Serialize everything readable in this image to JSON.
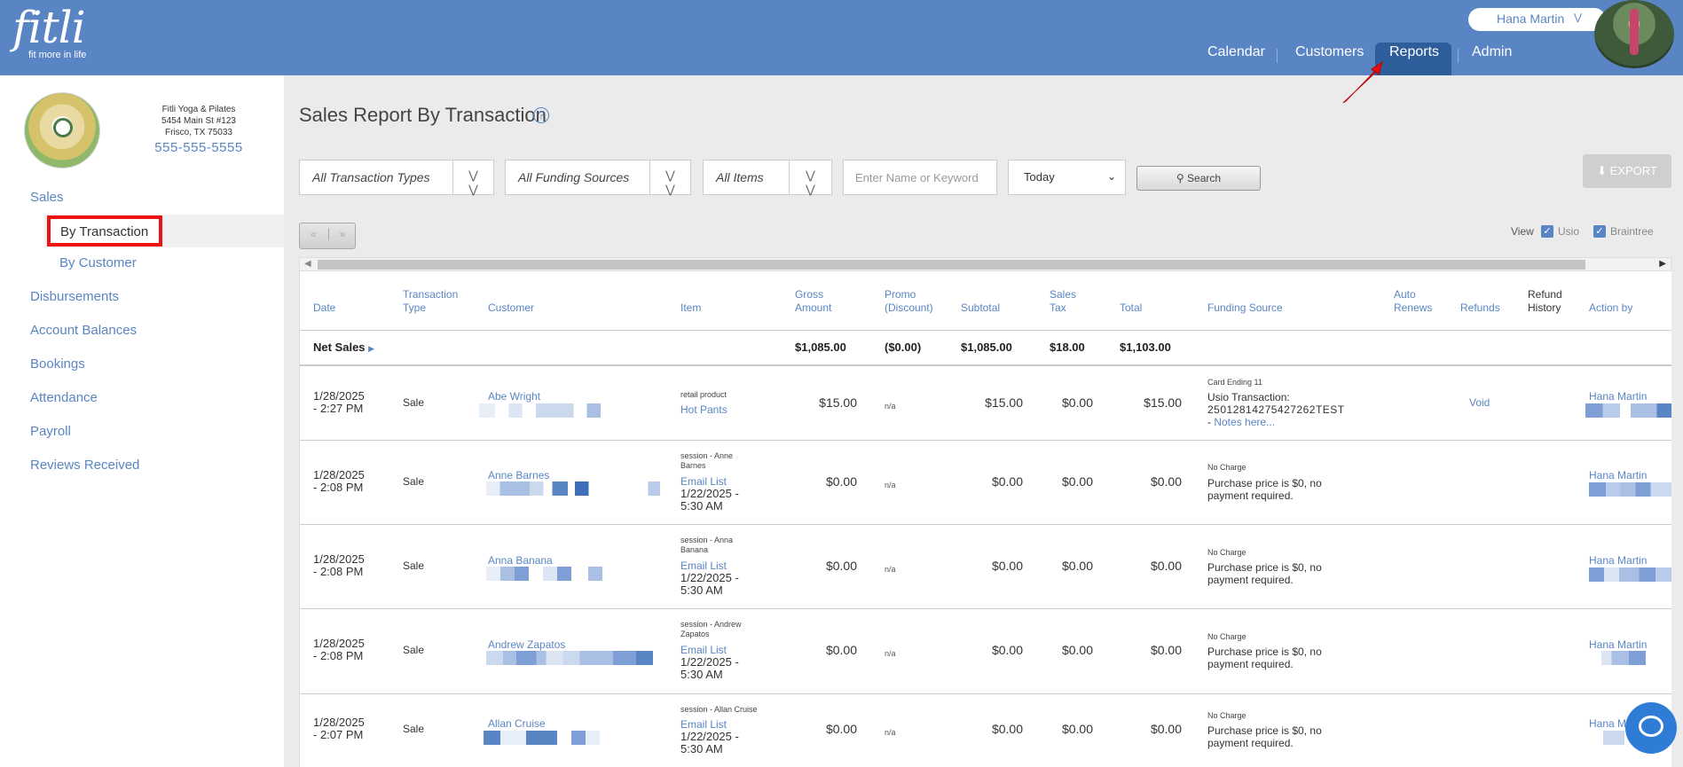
{
  "app": {
    "logo": "fitli",
    "tagline": "fit more in life"
  },
  "header": {
    "user_name": "Hana Martin",
    "nav": [
      {
        "label": "Calendar"
      },
      {
        "label": "Customers"
      },
      {
        "label": "Reports"
      },
      {
        "label": "Admin"
      }
    ]
  },
  "studio": {
    "name": "Fitli Yoga & Pilates",
    "address1": "5454 Main St #123",
    "address2": "Frisco, TX 75033",
    "phone": "555-555-5555"
  },
  "sidebar": {
    "items": [
      {
        "label": "Sales"
      },
      {
        "label": "By Transaction"
      },
      {
        "label": "By Customer"
      },
      {
        "label": "Disbursements"
      },
      {
        "label": "Account Balances"
      },
      {
        "label": "Bookings"
      },
      {
        "label": "Attendance"
      },
      {
        "label": "Payroll"
      },
      {
        "label": "Reviews Received"
      }
    ]
  },
  "page": {
    "title": "Sales Report By Transaction",
    "help": "?"
  },
  "filters": {
    "transaction_types": "All Transaction Types",
    "funding_sources": "All Funding Sources",
    "items": "All Items",
    "keyword_placeholder": "Enter Name or Keyword",
    "date_range": "Today",
    "search_label": "Search",
    "export_label": "EXPORT"
  },
  "pager": {
    "prev": "«",
    "next": "»"
  },
  "view": {
    "label": "View",
    "options": [
      "Usio",
      "Braintree"
    ]
  },
  "table": {
    "headers": {
      "date": "Date",
      "type1": "Transaction",
      "type2": "Type",
      "customer": "Customer",
      "item": "Item",
      "gross1": "Gross",
      "gross2": "Amount",
      "promo1": "Promo",
      "promo2": "(Discount)",
      "subtotal": "Subtotal",
      "tax1": "Sales",
      "tax2": "Tax",
      "total": "Total",
      "funding": "Funding Source",
      "auto1": "Auto",
      "auto2": "Renews",
      "refunds": "Refunds",
      "rh1": "Refund",
      "rh2": "History",
      "action": "Action by"
    },
    "net_sales": {
      "label": "Net Sales",
      "gross": "$1,085.00",
      "promo": "($0.00)",
      "subtotal": "$1,085.00",
      "tax": "$18.00",
      "total": "$1,103.00"
    },
    "rows": [
      {
        "date1": "1/28/2025",
        "date2": "- 2:27 PM",
        "type": "Sale",
        "customer": "Abe Wright",
        "item_type": "retail product",
        "item_name": "Hot Pants",
        "gross": "$15.00",
        "promo": "n/a",
        "subtotal": "$15.00",
        "tax": "$0.00",
        "total": "$15.00",
        "funding_small": "Card Ending 11",
        "funding1": "Usio Transaction:",
        "funding2": "25012814275427262TEST",
        "notes": "Notes here...",
        "refund": "Void",
        "action": "Hana Martin"
      },
      {
        "date1": "1/28/2025",
        "date2": "- 2:08 PM",
        "type": "Sale",
        "customer": "Anne Barnes",
        "item_type1": "session - Anne",
        "item_type2": "Barnes",
        "item_name": "Email List",
        "item_date1": "1/22/2025 -",
        "item_date2": "5:30 AM",
        "gross": "$0.00",
        "promo": "n/a",
        "subtotal": "$0.00",
        "tax": "$0.00",
        "total": "$0.00",
        "funding_small": "No Charge",
        "funding1": "Purchase price is $0, no",
        "funding2": "payment required.",
        "action": "Hana Martin"
      },
      {
        "date1": "1/28/2025",
        "date2": "- 2:08 PM",
        "type": "Sale",
        "customer": "Anna Banana",
        "item_type1": "session - Anna",
        "item_type2": "Banana",
        "item_name": "Email List",
        "item_date1": "1/22/2025 -",
        "item_date2": "5:30 AM",
        "gross": "$0.00",
        "promo": "n/a",
        "subtotal": "$0.00",
        "tax": "$0.00",
        "total": "$0.00",
        "funding_small": "No Charge",
        "funding1": "Purchase price is $0, no",
        "funding2": "payment required.",
        "action": "Hana Martin"
      },
      {
        "date1": "1/28/2025",
        "date2": "- 2:08 PM",
        "type": "Sale",
        "customer": "Andrew Zapatos",
        "item_type1": "session - Andrew",
        "item_type2": "Zapatos",
        "item_name": "Email List",
        "item_date1": "1/22/2025 -",
        "item_date2": "5:30 AM",
        "gross": "$0.00",
        "promo": "n/a",
        "subtotal": "$0.00",
        "tax": "$0.00",
        "total": "$0.00",
        "funding_small": "No Charge",
        "funding1": "Purchase price is $0, no",
        "funding2": "payment required.",
        "action": "Hana Martin"
      },
      {
        "date1": "1/28/2025",
        "date2": "- 2:07 PM",
        "type": "Sale",
        "customer": "Allan Cruise",
        "item_type1": "session - Allan Cruise",
        "item_type2": "",
        "item_name": "Email List",
        "item_date1": "1/22/2025 -",
        "item_date2": "5:30 AM",
        "gross": "$0.00",
        "promo": "n/a",
        "subtotal": "$0.00",
        "tax": "$0.00",
        "total": "$0.00",
        "funding_small": "No Charge",
        "funding1": "Purchase price is $0, no",
        "funding2": "payment required.",
        "action": "Hana Ma"
      }
    ]
  },
  "colors": {
    "header_bg": "#5985c4",
    "nav_active": "#2e5d9c",
    "link": "#5985c4",
    "highlight": "#e11111"
  }
}
